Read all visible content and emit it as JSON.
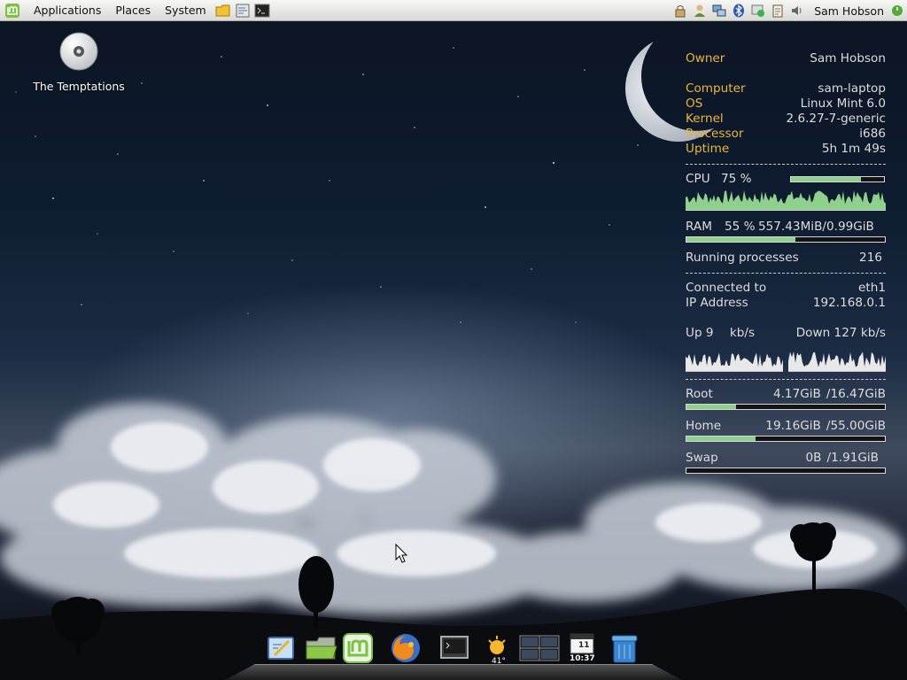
{
  "top_panel": {
    "menus": [
      "Applications",
      "Places",
      "System"
    ],
    "user": "Sam Hobson"
  },
  "desktop_icon": {
    "label": "The Temptations"
  },
  "conky": {
    "owner": {
      "label": "Owner",
      "value": "Sam Hobson"
    },
    "system": [
      {
        "label": "Computer",
        "value": "sam-laptop"
      },
      {
        "label": "OS",
        "value": "Linux Mint 6.0"
      },
      {
        "label": "Kernel",
        "value": "2.6.27-7-generic"
      },
      {
        "label": "Processor",
        "value": "i686"
      },
      {
        "label": "Uptime",
        "value": "5h 1m 49s"
      }
    ],
    "cpu": {
      "label": "CPU",
      "value": "75 %",
      "usage": 0.75
    },
    "ram": {
      "label": "RAM",
      "value": "55 %",
      "amount": "557.43MiB/0.99GiB",
      "usage": 0.55
    },
    "processes": {
      "label": "Running processes",
      "value": "216"
    },
    "network": {
      "connected_label": "Connected to",
      "connected_value": "eth1",
      "ip_label": "IP Address",
      "ip_value": "192.168.0.1",
      "up_label": "Up",
      "up_value": "9",
      "up_unit": "kb/s",
      "down_label": "Down",
      "down_value": "127",
      "down_unit": "kb/s"
    },
    "disks": [
      {
        "label": "Root",
        "used": "4.17GiB",
        "total": "/16.47GiB",
        "usage": 0.25
      },
      {
        "label": "Home",
        "used": "19.16GiB",
        "total": "/55.00GiB",
        "usage": 0.35
      },
      {
        "label": "Swap",
        "used": "0B",
        "total": "/1.91GiB",
        "usage": 0.0
      }
    ]
  },
  "dock": {
    "weather_temp": "41°",
    "clock_time": "10:37",
    "calendar_day": "11"
  }
}
